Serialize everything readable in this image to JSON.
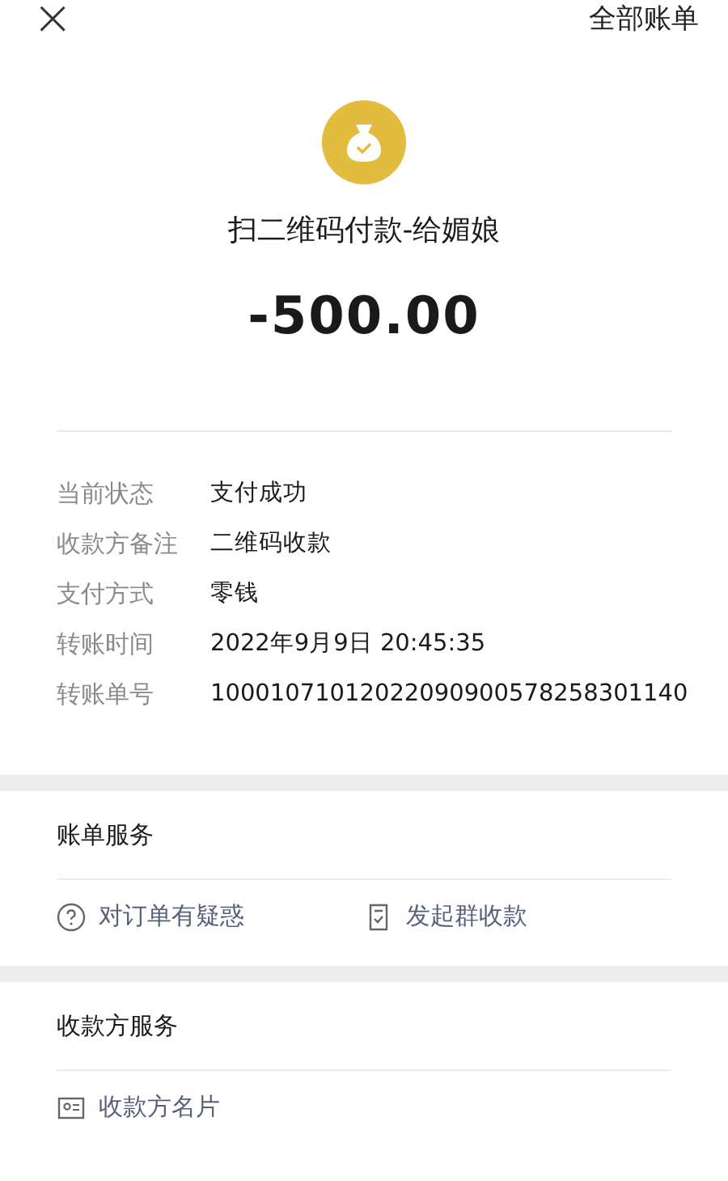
{
  "top_bar": {
    "close": "×",
    "all_bills": "全部账单"
  },
  "payment": {
    "title": "扫二维码付款-给媚娘",
    "amount": "-500.00"
  },
  "details": [
    {
      "label": "当前状态",
      "value": "支付成功"
    },
    {
      "label": "收款方备注",
      "value": "二维码收款"
    },
    {
      "label": "支付方式",
      "value": "零钱"
    },
    {
      "label": "转账时间",
      "value": "2022年9月9日 20:45:35"
    },
    {
      "label": "转账单号",
      "value": "10001071012022090900578258301140"
    }
  ],
  "bill_services": {
    "title": "账单服务",
    "actions": [
      {
        "kind": "question",
        "label": "对订单有疑惑"
      },
      {
        "kind": "split",
        "label": "发起群收款"
      }
    ]
  },
  "payee_services": {
    "title": "收款方服务",
    "actions": [
      {
        "kind": "card",
        "label": "收款方名片"
      }
    ]
  }
}
